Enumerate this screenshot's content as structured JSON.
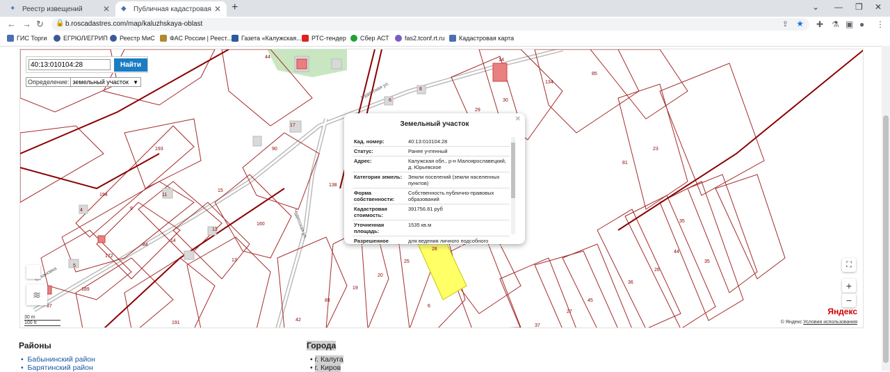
{
  "browser": {
    "tabs": [
      {
        "title": "Реестр извещений",
        "active": false
      },
      {
        "title": "Публичная кадастровая карта: К",
        "active": true
      }
    ],
    "url": "b.roscadastres.com/map/kaluzhskaya-oblast",
    "bookmarks": [
      {
        "label": "ГИС Торги",
        "color": "#4a6fb5"
      },
      {
        "label": "ЕГРЮЛ/ЕГРИП",
        "color": "#3b5998"
      },
      {
        "label": "Реестр МиС",
        "color": "#3b5998"
      },
      {
        "label": "ФАС России | Реест...",
        "color": "#b08a2e"
      },
      {
        "label": "Газета «Калужская...",
        "color": "#2a5b9b"
      },
      {
        "label": "РТС-тендер",
        "color": "#d22"
      },
      {
        "label": "Сбер АСТ",
        "color": "#21a038"
      },
      {
        "label": "fas2.tconf.rt.ru",
        "color": "#7a5cc4"
      },
      {
        "label": "Кадастровая карта",
        "color": "#4a6fb5"
      }
    ]
  },
  "map": {
    "search_value": "40:13:010104:28",
    "search_button": "Найти",
    "definition_label": "Определение:",
    "definition_value": "земельный участок",
    "popup": {
      "title": "Земельный участок",
      "rows": [
        {
          "key": "Кад. номер:",
          "value": "40:13:010104:28"
        },
        {
          "key": "Статус:",
          "value": "Ранее учтенный"
        },
        {
          "key": "Адрес:",
          "value": "Калужская обл., р-н Малоярославецкий, д. Юрьевское"
        },
        {
          "key": "Категория земель:",
          "value": "Земли поселений (земли населенных пунктов)"
        },
        {
          "key": "Форма собственности:",
          "value": "Собственность публично-правовых образований"
        },
        {
          "key": "Кадастровая стоимость:",
          "value": "391756.81 руб"
        },
        {
          "key": "Уточненная площадь:",
          "value": "1535 кв.м"
        },
        {
          "key": "Разрешенное",
          "value": "для ведения личного подсобного"
        }
      ]
    },
    "streets": [
      "Чудесская ул.",
      "Чудесская ул.",
      "Сухановка"
    ],
    "parcel_numbers": [
      "44",
      "14",
      "134",
      "85",
      "30",
      "29",
      "8",
      "6",
      "17",
      "90",
      "193",
      "194",
      "4",
      "9",
      "11",
      "15",
      "138",
      "160",
      "13",
      "14",
      "84",
      "172",
      "5",
      "189",
      "191",
      "87",
      "13",
      "89",
      "42",
      "20",
      "19",
      "25",
      "6",
      "37",
      "27",
      "45",
      "36",
      "26",
      "44",
      "35",
      "35",
      "23",
      "81",
      "28"
    ],
    "scale_top": "30 m",
    "scale_bottom": "100 ft",
    "yandex": "Яндекс",
    "copyright": "© Яндекс",
    "terms": "Условия использования"
  },
  "page": {
    "col1_heading": "Районы",
    "col1_items": [
      "Бабынинский район",
      "Барятинский район"
    ],
    "col2_heading": "Города",
    "col2_items": [
      "г. Калуга",
      "г. Киров"
    ]
  }
}
